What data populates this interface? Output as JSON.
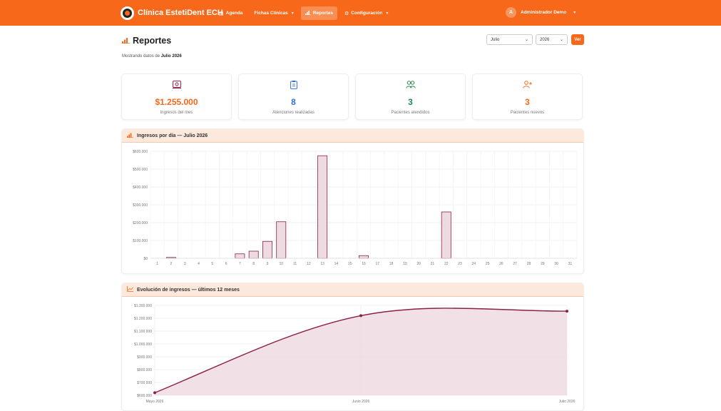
{
  "app": {
    "brand": "Clínica EstetiDent ECH"
  },
  "nav": {
    "items": [
      {
        "label": "Agenda",
        "icon": "calendar-icon"
      },
      {
        "label": "Fichas Clínicas",
        "icon": "",
        "dropdown": true
      },
      {
        "label": "Reportes",
        "icon": "bar-chart-icon",
        "active": true
      },
      {
        "label": "Configuración",
        "icon": "gear-icon",
        "dropdown": true
      }
    ],
    "user": {
      "initial": "A",
      "name": "Administrador Demo"
    }
  },
  "page": {
    "title": "Reportes",
    "subtitle_prefix": "Mostrando datos de",
    "subtitle_period": "Julio 2026"
  },
  "filters": {
    "month": "Julio",
    "year": "2026",
    "submit_label": "Ver"
  },
  "stats": [
    {
      "value": "$1.255.000",
      "label": "Ingresos del mes",
      "icon": "money-icon",
      "color": "#f7681a",
      "icon_color": "#8b1e4a"
    },
    {
      "value": "8",
      "label": "Atenciones realizadas",
      "icon": "clipboard-icon",
      "color": "#2f6fd6",
      "icon_color": "#2f6fd6"
    },
    {
      "value": "3",
      "label": "Pacientes atendidos",
      "icon": "users-icon",
      "color": "#1f8a4c",
      "icon_color": "#1f8a4c"
    },
    {
      "value": "3",
      "label": "Pacientes nuevos",
      "icon": "user-plus-icon",
      "color": "#f7681a",
      "icon_color": "#f7681a"
    }
  ],
  "panels": {
    "daily_title": "Ingresos por día — Julio 2026",
    "evolution_title": "Evolución de ingresos — últimos 12 meses"
  },
  "colors": {
    "accent": "#f7681a",
    "bar_fill": "#eedbe2",
    "bar_stroke": "#8b1e4a",
    "line": "#8b1e4a"
  },
  "chart_data": [
    {
      "type": "bar",
      "categories": [
        "1",
        "2",
        "3",
        "4",
        "5",
        "6",
        "7",
        "8",
        "9",
        "10",
        "11",
        "12",
        "13",
        "14",
        "15",
        "16",
        "17",
        "18",
        "19",
        "20",
        "21",
        "22",
        "23",
        "24",
        "25",
        "26",
        "27",
        "28",
        "29",
        "30",
        "31"
      ],
      "values": [
        0,
        5000,
        0,
        0,
        0,
        0,
        25000,
        40000,
        95000,
        205000,
        0,
        0,
        575000,
        0,
        0,
        15000,
        0,
        0,
        0,
        0,
        0,
        260000,
        0,
        0,
        0,
        0,
        0,
        0,
        0,
        0,
        0
      ],
      "ylim": [
        0,
        600000
      ],
      "yticks": [
        "$0",
        "$100.000",
        "$200.000",
        "$300.000",
        "$400.000",
        "$500.000",
        "$600.000"
      ],
      "grid": true
    },
    {
      "type": "area",
      "categories": [
        "Mayo 2026",
        "Junio 2026",
        "Julio 2026"
      ],
      "values": [
        620000,
        1220000,
        1255000
      ],
      "ylim": [
        600000,
        1300000
      ],
      "yticks": [
        "$600.000",
        "$700.000",
        "$800.000",
        "$900.000",
        "$1.000.000",
        "$1.100.000",
        "$1.200.000",
        "$1.300.000"
      ],
      "grid": true
    }
  ]
}
